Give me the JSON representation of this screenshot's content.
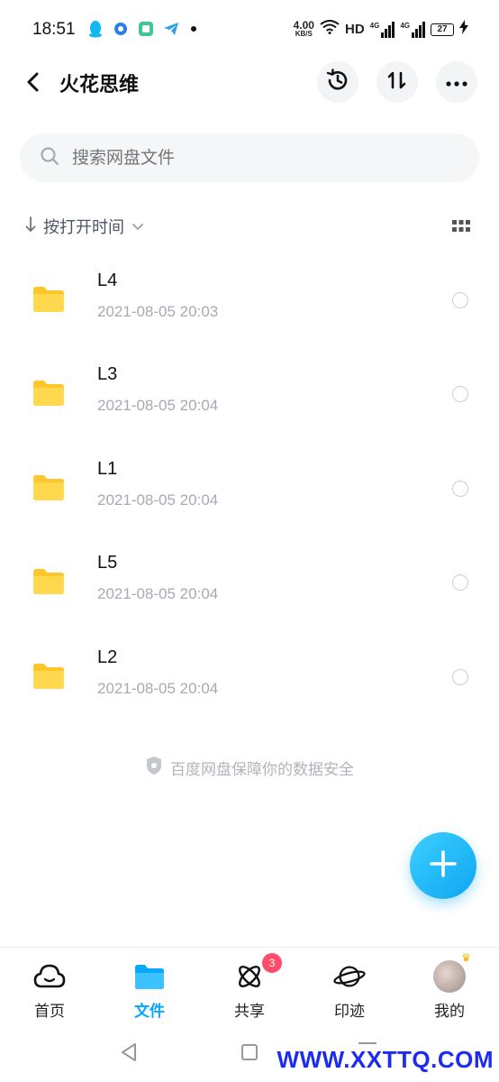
{
  "status_bar": {
    "time": "18:51",
    "speed_value": "4.00",
    "speed_unit": "KB/S",
    "hd_label": "HD",
    "net_label_1": "4G",
    "net_label_2": "4G",
    "battery": "27",
    "app_icons": [
      "qq-icon",
      "notification-icon",
      "app-icon",
      "telegram-icon"
    ]
  },
  "header": {
    "title": "火花思维",
    "icons": [
      "history-icon",
      "sort-icon",
      "more-icon"
    ]
  },
  "search": {
    "placeholder": "搜索网盘文件"
  },
  "sort": {
    "label": "按打开时间"
  },
  "files": [
    {
      "name": "L4",
      "date": "2021-08-05  20:03"
    },
    {
      "name": "L3",
      "date": "2021-08-05  20:04"
    },
    {
      "name": "L1",
      "date": "2021-08-05  20:04"
    },
    {
      "name": "L5",
      "date": "2021-08-05  20:04"
    },
    {
      "name": "L2",
      "date": "2021-08-05  20:04"
    }
  ],
  "footer_note": "百度网盘保障你的数据安全",
  "bottom_nav": {
    "items": [
      {
        "label": "首页",
        "icon": "cloud-icon"
      },
      {
        "label": "文件",
        "icon": "folder-icon",
        "active": true
      },
      {
        "label": "共享",
        "icon": "atom-icon",
        "badge": "3"
      },
      {
        "label": "印迹",
        "icon": "planet-icon"
      },
      {
        "label": "我的",
        "icon": "avatar"
      }
    ]
  },
  "watermark": "WWW.XXTTQ.COM",
  "colors": {
    "accent": "#06a7ff",
    "folder": "#ffd43b",
    "badge": "#ff4d6a"
  }
}
